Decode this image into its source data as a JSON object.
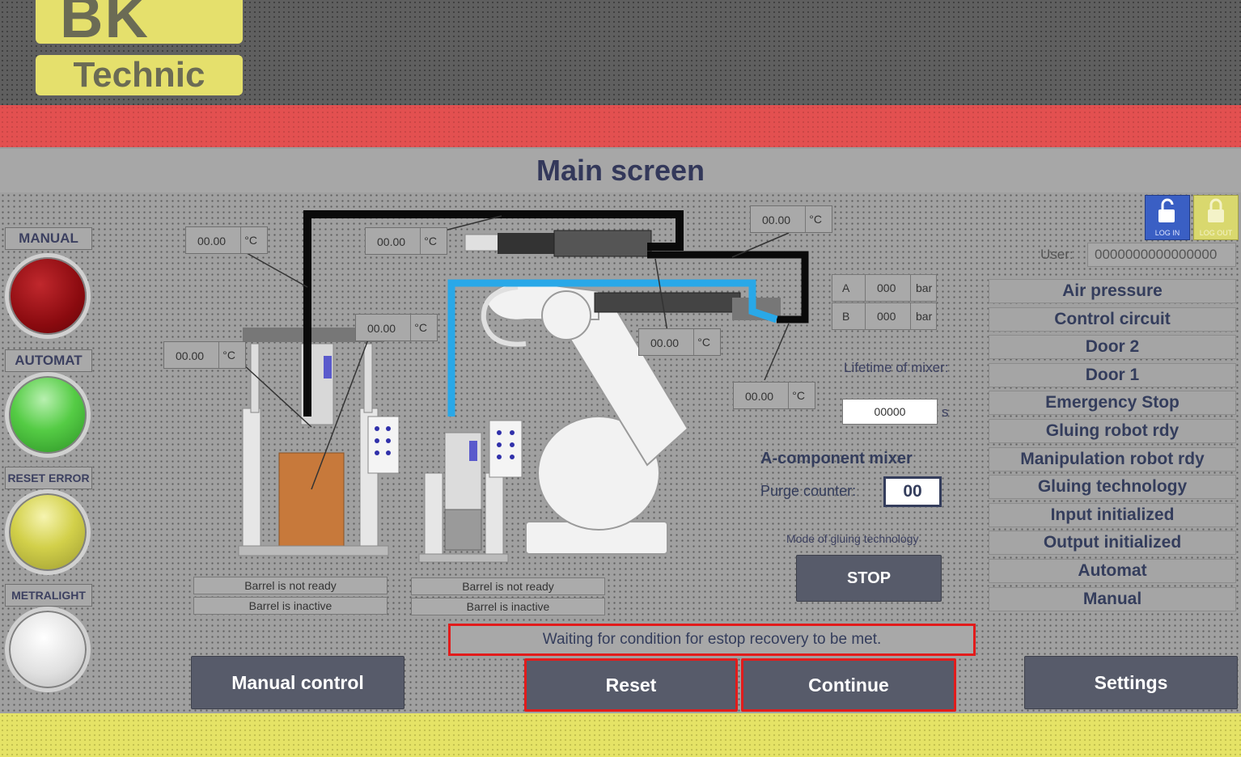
{
  "logo": {
    "text_top": "BK",
    "text_bottom": "Technic"
  },
  "title": "Main screen",
  "lamps": [
    {
      "label": "MANUAL",
      "color": "#9b0d12"
    },
    {
      "label": "AUTOMAT",
      "color": "#4cc73f"
    },
    {
      "label": "RESET ERROR",
      "color": "#d1cf48"
    },
    {
      "label": "METRALIGHT",
      "color": "#dcdcdc"
    }
  ],
  "temps": {
    "t1": {
      "value": "00.00",
      "unit": "°C"
    },
    "t2": {
      "value": "00.00",
      "unit": "°C"
    },
    "t3": {
      "value": "00.00",
      "unit": "°C"
    },
    "t4": {
      "value": "00.00",
      "unit": "°C"
    },
    "t5": {
      "value": "00.00",
      "unit": "°C"
    },
    "t6": {
      "value": "00.00",
      "unit": "°C"
    },
    "t7": {
      "value": "00.00",
      "unit": "°C"
    }
  },
  "pressure": {
    "a": {
      "label": "A",
      "value": "000",
      "unit": "bar"
    },
    "b": {
      "label": "B",
      "value": "000",
      "unit": "bar"
    }
  },
  "login": {
    "login_label": "LOG IN",
    "logout_label": "LOG OUT",
    "user_label": "User:",
    "user_value": "0000000000000000"
  },
  "mixer": {
    "lifetime_label": "Lifetime of mixer:",
    "lifetime_value": "00000",
    "lifetime_unit": "s",
    "component_label": "A-component mixer",
    "purge_label": "Purge counter:",
    "purge_value": "00",
    "mode_label": "Mode of gluing technology",
    "stop_label": "STOP"
  },
  "status_items": [
    "Air pressure",
    "Control circuit",
    "Door 2",
    "Door 1",
    "Emergency Stop",
    "Gluing robot rdy",
    "Manipulation robot rdy",
    "Gluing technology",
    "Input initialized",
    "Output initialized",
    "Automat",
    "Manual"
  ],
  "barrels": {
    "left": {
      "ready": "Barrel is not ready",
      "active": "Barrel is inactive"
    },
    "right": {
      "ready": "Barrel is not ready",
      "active": "Barrel is inactive"
    }
  },
  "message": "Waiting for condition for estop recovery to be met.",
  "buttons": {
    "manual_control": "Manual control",
    "reset": "Reset",
    "continue": "Continue",
    "settings": "Settings"
  }
}
